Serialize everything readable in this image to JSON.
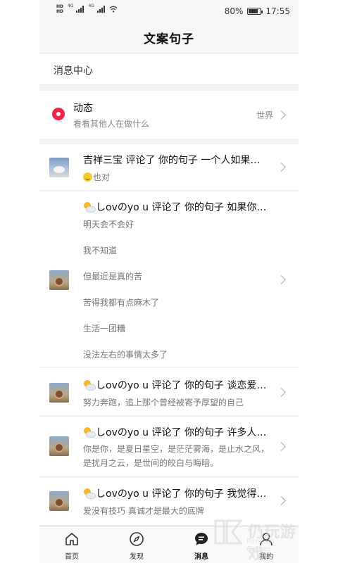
{
  "status_bar": {
    "network_left": "HD",
    "network_right": "HD",
    "signal_label_1": "4G",
    "signal_label_2": "4G",
    "battery_percent": "80%",
    "battery_level": 0.8,
    "time": "17:55"
  },
  "header": {
    "title": "文案句子"
  },
  "message_center": {
    "label": "消息中心"
  },
  "dynamic": {
    "title": "动态",
    "subtitle": "看看其他人在做什么",
    "scope": "世界"
  },
  "notifications": [
    {
      "line1": "吉祥三宝 评论了 你的句子 一个人如果…",
      "line2": "也对"
    },
    {
      "line1": "しovのyo u 评论了 你的句子 如果你…",
      "comment_lines": [
        "明天会不会好",
        "我不知道",
        "但最近是真的苦",
        "苦得我都有点麻木了",
        "生活一团糟",
        "没法左右的事情太多了"
      ]
    },
    {
      "line1": "しovのyo u 评论了 你的句子 谈恋爱…",
      "line2": "努力奔跑，追上那个曾经被寄予厚望的自己"
    },
    {
      "line1": "しovのyo u 评论了 你的句子 许多人…",
      "line2": "你是你，是夏日星空，是茫茫雾海，是止水之风，是扰月之云，是世间的皎白与晦暗。"
    },
    {
      "line1": "しovのyo u 评论了 你的句子 我觉得…",
      "line2": "爱没有技巧 真诚才是最大的底牌"
    }
  ],
  "tabbar": {
    "tabs": [
      {
        "label": "首页",
        "icon": "home-icon"
      },
      {
        "label": "发现",
        "icon": "compass-icon"
      },
      {
        "label": "消息",
        "icon": "message-icon",
        "active": true
      },
      {
        "label": "我的",
        "icon": "user-icon"
      }
    ]
  },
  "watermark": {
    "text": "仍玩游戏",
    "sub": "Renwan Games"
  }
}
